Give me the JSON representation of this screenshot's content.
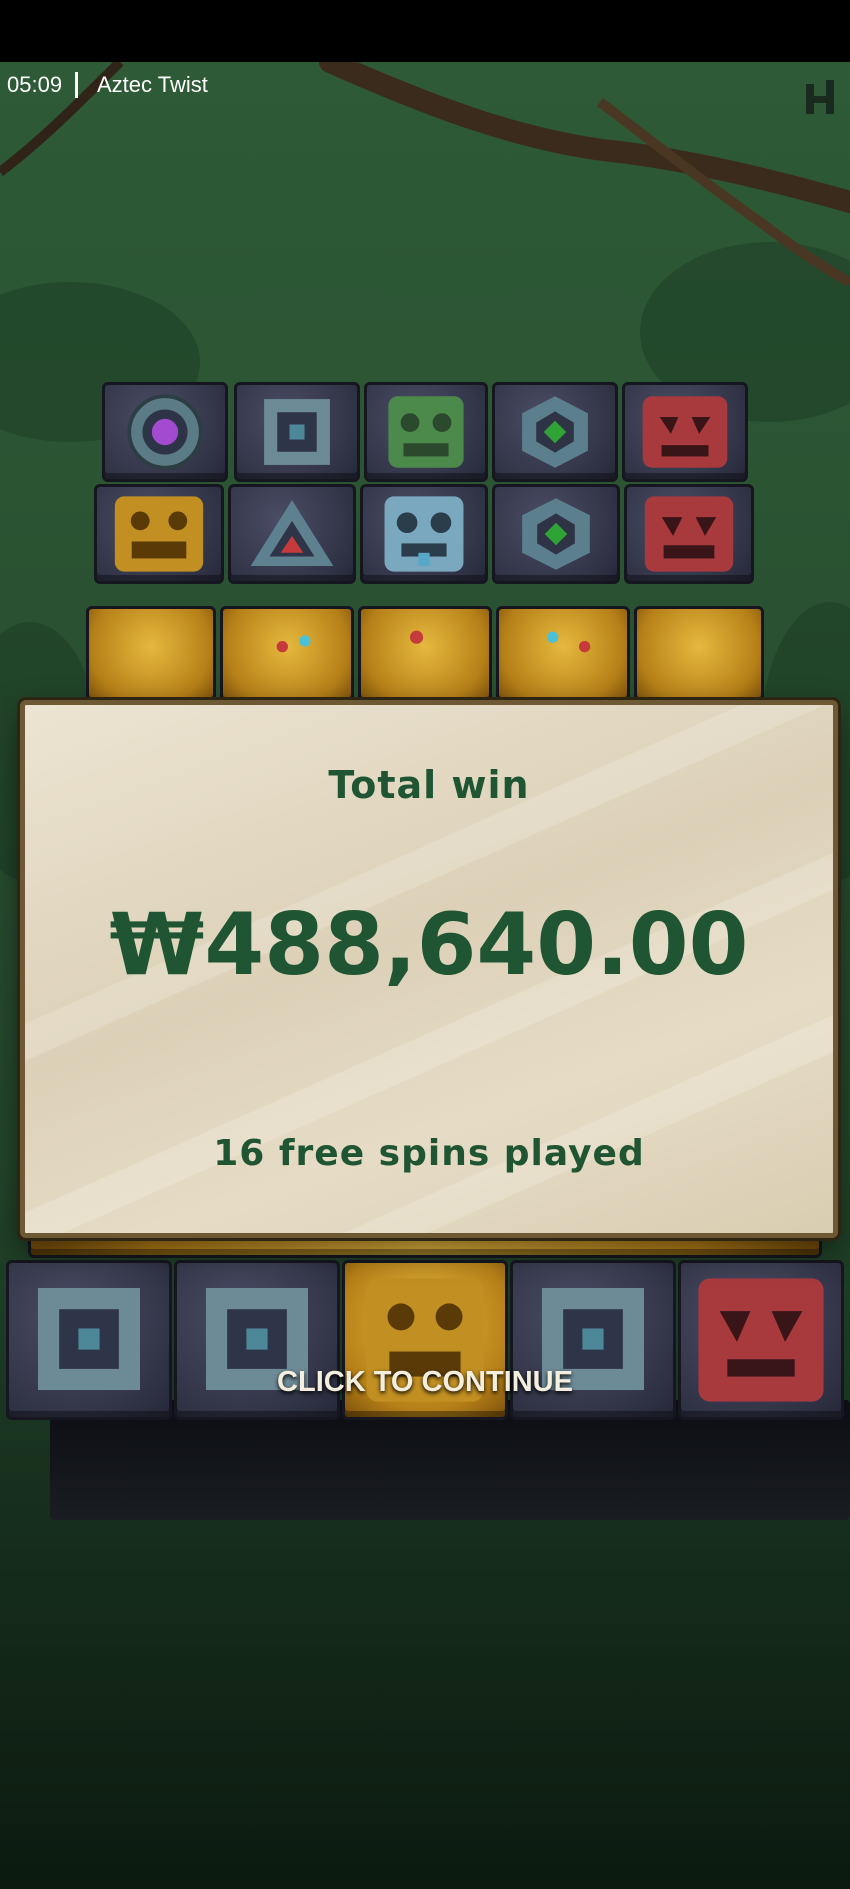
{
  "status_bar": {
    "time": "05:09",
    "app_title": "Aztec Twist"
  },
  "icons": {
    "home": "house-logo-icon"
  },
  "board": {
    "top_row_1": [
      "purple-circle-rune",
      "square-rune",
      "green-mask",
      "green-diamond-rune",
      "red-mask"
    ],
    "top_row_2": [
      "gold-mask",
      "red-triangle-rune",
      "blue-mask",
      "green-diamond-rune",
      "red-mask"
    ],
    "gold_row": [
      "gold-calendar",
      "gold-calendar",
      "gold-calendar",
      "gold-calendar",
      "gold-calendar"
    ],
    "bottom_row": [
      "square-rune",
      "square-rune",
      "gold-mask",
      "square-rune",
      "red-mask"
    ]
  },
  "win_panel": {
    "title": "Total win",
    "amount": "₩488,640.00",
    "spins_text": "16 free spins played"
  },
  "continue_label": "CLICK TO CONTINUE",
  "colors": {
    "panel_text": "#1f5532",
    "panel_bg": "#e6dcc6",
    "background": "#2a5232"
  }
}
